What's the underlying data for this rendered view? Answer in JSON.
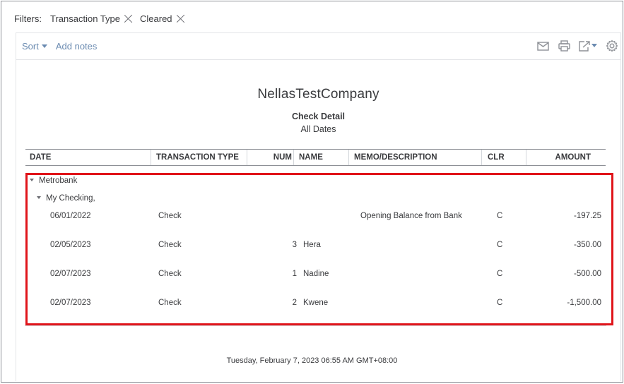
{
  "filters": {
    "label": "Filters:",
    "chips": [
      "Transaction Type",
      "Cleared"
    ]
  },
  "toolbar": {
    "sort_label": "Sort",
    "add_notes_label": "Add notes",
    "icons": [
      "email-icon",
      "print-icon",
      "export-icon",
      "settings-icon"
    ]
  },
  "report": {
    "company": "NellasTestCompany",
    "title": "Check Detail",
    "dates": "All Dates",
    "columns": [
      "DATE",
      "TRANSACTION TYPE",
      "NUM",
      "NAME",
      "MEMO/DESCRIPTION",
      "CLR",
      "AMOUNT"
    ],
    "group": "Metrobank",
    "subgroup": "My Checking,",
    "rows": [
      {
        "date": "06/01/2022",
        "type": "Check",
        "num": "",
        "name": "",
        "memo": "Opening Balance from Bank",
        "clr": "C",
        "amount": "-197.25"
      },
      {
        "date": "02/05/2023",
        "type": "Check",
        "num": "3",
        "name": "Hera",
        "memo": "",
        "clr": "C",
        "amount": "-350.00"
      },
      {
        "date": "02/07/2023",
        "type": "Check",
        "num": "1",
        "name": "Nadine",
        "memo": "",
        "clr": "C",
        "amount": "-500.00"
      },
      {
        "date": "02/07/2023",
        "type": "Check",
        "num": "2",
        "name": "Kwene",
        "memo": "",
        "clr": "C",
        "amount": "-1,500.00"
      }
    ],
    "footer": "Tuesday, February 7, 2023   06:55 AM GMT+08:00"
  },
  "colors": {
    "link": "#6b8bb1",
    "highlight": "#e0141a",
    "text": "#393a3d"
  }
}
